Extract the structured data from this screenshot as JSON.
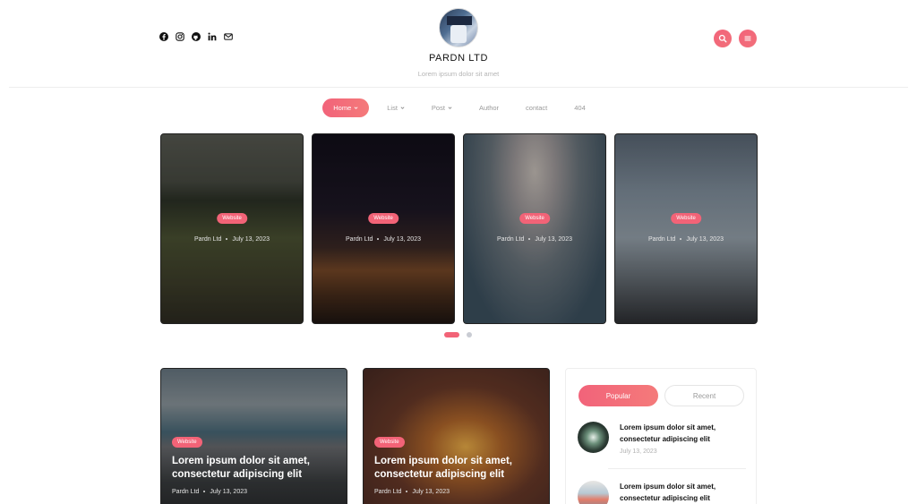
{
  "header": {
    "social": [
      {
        "icon": "facebook-icon"
      },
      {
        "icon": "instagram-icon"
      },
      {
        "icon": "github-icon"
      },
      {
        "icon": "linkedin-icon"
      },
      {
        "icon": "mail-icon"
      }
    ],
    "site_title": "PARDN LTD",
    "tagline": "Lorem ipsum dolor sit amet",
    "accent_color": "#f2637a"
  },
  "nav": {
    "items": [
      {
        "label": "Home",
        "active": true,
        "has_caret": true
      },
      {
        "label": "List",
        "has_caret": true
      },
      {
        "label": "Post",
        "has_caret": true
      },
      {
        "label": "Author"
      },
      {
        "label": "contact"
      },
      {
        "label": "404"
      }
    ]
  },
  "slider": {
    "slides": [
      {
        "category": "Website",
        "author": "Pardn Ltd",
        "date": "July 13, 2023"
      },
      {
        "category": "Website",
        "author": "Pardn Ltd",
        "date": "July 13, 2023"
      },
      {
        "category": "Website",
        "author": "Pardn Ltd",
        "date": "July 13, 2023"
      },
      {
        "category": "Website",
        "author": "Pardn Ltd",
        "date": "July 13, 2023"
      }
    ],
    "page_count": 2,
    "active_page": 1
  },
  "posts": [
    {
      "category": "Website",
      "title": "Lorem ipsum dolor sit amet, consectetur adipiscing elit",
      "author": "Pardn Ltd",
      "date": "July 13, 2023"
    },
    {
      "category": "Website",
      "title": "Lorem ipsum dolor sit amet, consectetur adipiscing elit",
      "author": "Pardn Ltd",
      "date": "July 13, 2023"
    }
  ],
  "widget": {
    "tabs": [
      {
        "label": "Popular",
        "active": true
      },
      {
        "label": "Recent"
      }
    ],
    "items": [
      {
        "title": "Lorem ipsum dolor sit amet, consectetur adipiscing elit",
        "date": "July 13, 2023"
      },
      {
        "title": "Lorem ipsum dolor sit amet, consectetur adipiscing elit",
        "date": ""
      }
    ]
  }
}
